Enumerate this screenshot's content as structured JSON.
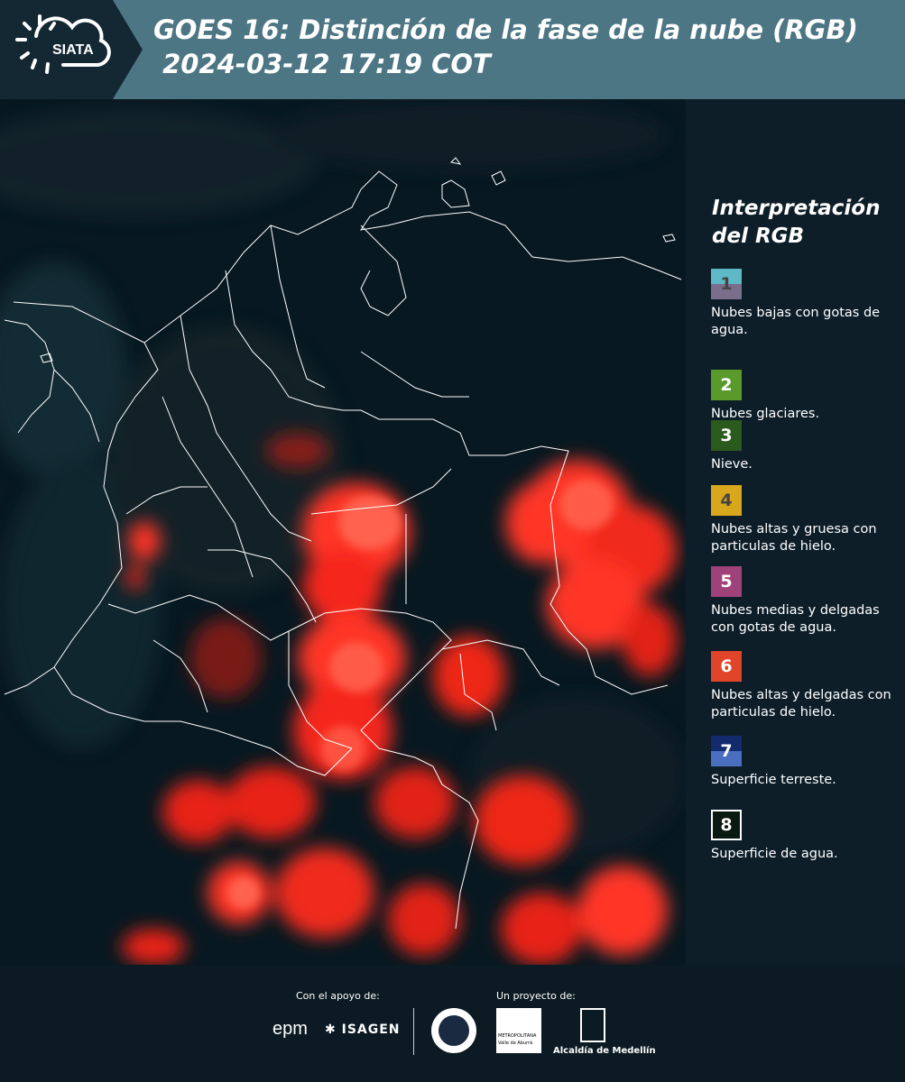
{
  "header": {
    "title_line1": "GOES 16: Distinción de la fase de la nube (RGB)",
    "title_line2": " 2024-03-12 17:19 COT",
    "logo_text": "SIATA",
    "background_color": "#4d7684"
  },
  "map": {
    "icon": "satellite-rgb-map",
    "cloud_color": "#ff3020",
    "border_color": "#ffffff"
  },
  "legend": {
    "title": "Interpretación del RGB",
    "items": [
      {
        "number": "1",
        "label": "Nubes bajas con gotas de agua.",
        "color_top": "#5fb8c6",
        "color_bottom": "#7a6e8a"
      },
      {
        "number": "2",
        "label": "Nubes glaciares.",
        "color_top": "#5a9a2a",
        "color_bottom": "#5a9a2a"
      },
      {
        "number": "3",
        "label": "Nieve.",
        "color_top": "#2a5a1c",
        "color_bottom": "#2a5a1c"
      },
      {
        "number": "4",
        "label": "Nubes altas y gruesa con particulas de hielo.",
        "color_top": "#d9a71c",
        "color_bottom": "#d9a71c"
      },
      {
        "number": "5",
        "label": "Nubes medias y delgadas con gotas de agua.",
        "color_top": "#a0427a",
        "color_bottom": "#a0427a"
      },
      {
        "number": "6",
        "label": "Nubes altas y delgadas con particulas de hielo.",
        "color_top": "#e0452a",
        "color_bottom": "#e0452a"
      },
      {
        "number": "7",
        "label": "Superficie terreste.",
        "color_top": "#132a6e",
        "color_bottom": "#4a6fc0"
      },
      {
        "number": "8",
        "label": "Superficie de agua.",
        "color_top": "#0b1a10",
        "color_bottom": "#0b1a10"
      }
    ]
  },
  "footer": {
    "support_label": "Con el apoyo de:",
    "project_label": "Un proyecto de:",
    "brand_epm": "epm",
    "brand_isagen": "ISAGEN",
    "brand_area_line1": "METROPOLITANA",
    "brand_area_line2": "Valle de Aburrá",
    "brand_medellin": "Alcaldía de Medellín"
  }
}
